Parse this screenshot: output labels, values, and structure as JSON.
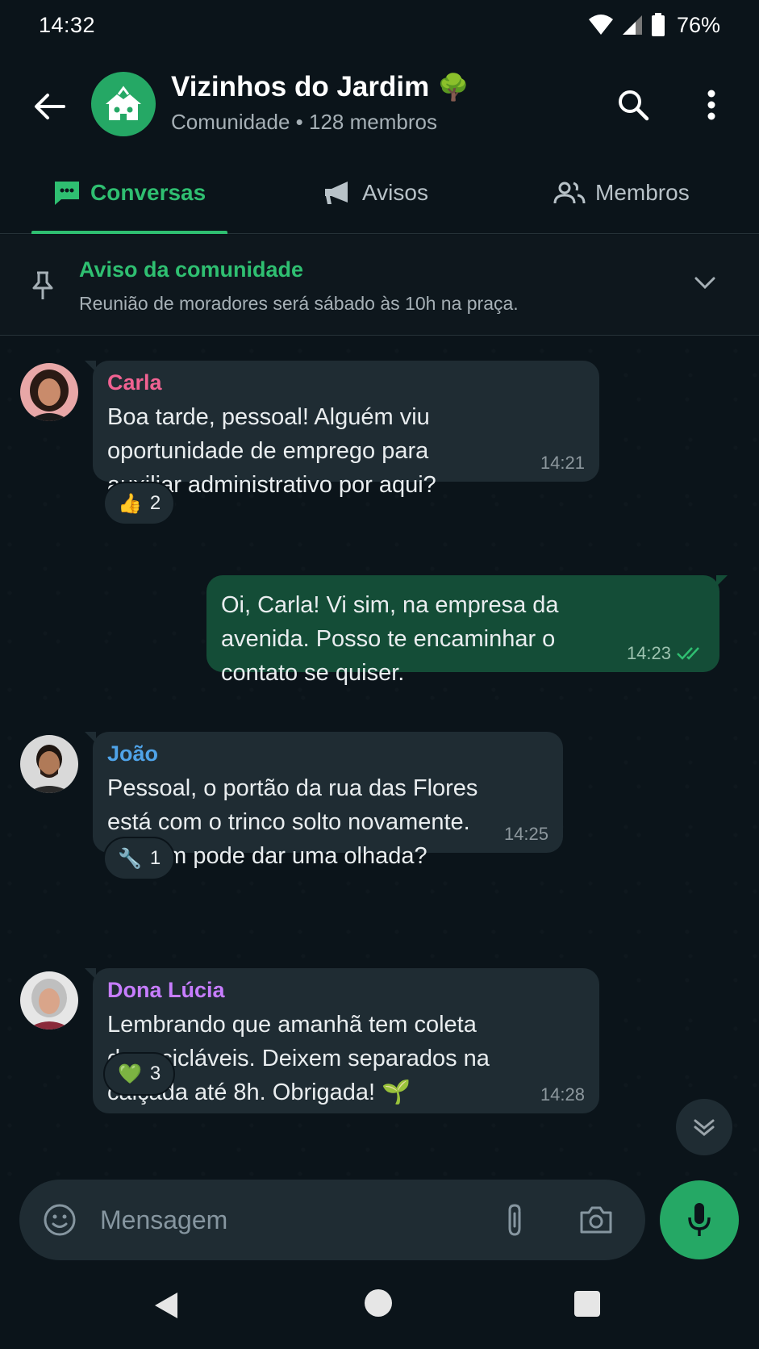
{
  "status_bar": {
    "time": "14:32",
    "battery": "76%"
  },
  "header": {
    "group_name": "Vizinhos do Jardim",
    "group_emoji": "🌳",
    "subtitle": "Comunidade • 128 membros"
  },
  "tabs": [
    {
      "label": "Conversas",
      "active": true
    },
    {
      "label": "Avisos",
      "active": false
    },
    {
      "label": "Membros",
      "active": false
    }
  ],
  "pinned": {
    "title": "Aviso da comunidade",
    "text": "Reunião de moradores será sábado às 10h na praça."
  },
  "messages": [
    {
      "sender": "Carla",
      "sender_color": "#f06292",
      "text": "Boa tarde, pessoal! Alguém viu oportunidade de emprego para auxiliar administrativo por aqui?",
      "time": "14:21",
      "reaction_emoji": "👍",
      "reaction_count": "2"
    },
    {
      "outgoing": true,
      "text": "Oi, Carla! Vi sim, na empresa da avenida. Posso te encaminhar o contato se quiser.",
      "time": "14:23"
    },
    {
      "sender": "João",
      "sender_color": "#4fa3e8",
      "text": "Pessoal, o portão da rua das Flores está com o trinco solto novamente. Alguém pode dar uma olhada?",
      "time": "14:25",
      "reaction_emoji": "🔧",
      "reaction_count": "1"
    },
    {
      "sender": "Dona Lúcia",
      "sender_color": "#c77dff",
      "text": "Lembrando que amanhã tem coleta de recicláveis. Deixem separados na calçada até 8h. Obrigada! 🌱",
      "time": "14:28",
      "reaction_emoji": "💚",
      "reaction_count": "3"
    }
  ],
  "composer": {
    "placeholder": "Mensagem"
  },
  "colors": {
    "accent": "#2fbf71",
    "outgoing_bubble": "#144d37",
    "incoming_bubble": "#1f2c33"
  }
}
